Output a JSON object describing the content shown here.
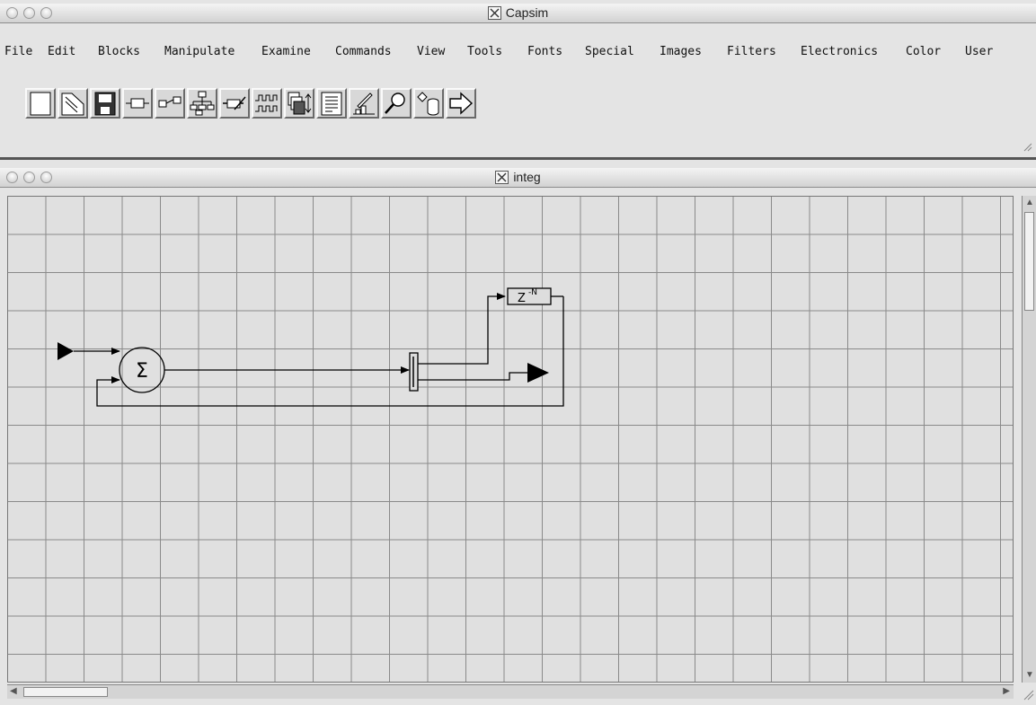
{
  "main_window": {
    "title": "Capsim"
  },
  "menu": {
    "file": "File",
    "edit": "Edit",
    "blocks": "Blocks",
    "manipulate": "Manipulate",
    "examine": "Examine",
    "commands": "Commands",
    "view": "View",
    "tools": "Tools",
    "fonts": "Fonts",
    "special": "Special",
    "images": "Images",
    "filters": "Filters",
    "electronics": "Electronics",
    "color": "Color",
    "user": "User"
  },
  "toolbar": {
    "icons": [
      "new-file-icon",
      "open-folder-icon",
      "save-disk-icon",
      "block-icon",
      "connect-blocks-icon",
      "hierarchy-icon",
      "edit-block-icon",
      "waveform-icon",
      "pages-sort-icon",
      "text-list-icon",
      "plot-draw-icon",
      "search-magnifier-icon",
      "database-icon",
      "forward-arrow-icon"
    ]
  },
  "canvas_window": {
    "title": "integ",
    "blocks": {
      "sum_symbol": "Σ",
      "delay_label": "Z",
      "delay_exponent": "-N"
    }
  },
  "colors": {
    "canvas_bg": "#e0e0e0",
    "grid": "#8a8a8a",
    "window_bg": "#e4e4e4"
  }
}
